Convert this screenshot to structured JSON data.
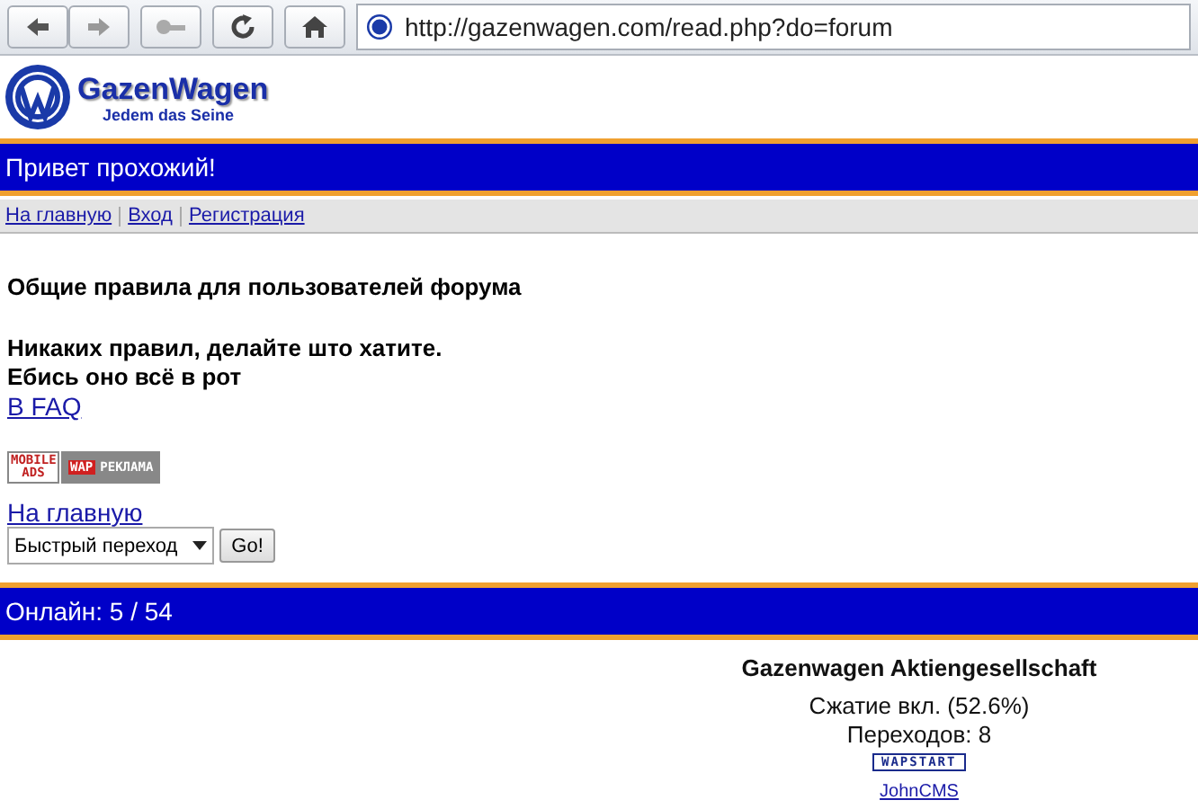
{
  "browser": {
    "url": "http://gazenwagen.com/read.php?do=forum"
  },
  "logo": {
    "name": "GazenWagen",
    "slogan": "Jedem das Seine"
  },
  "greeting": "Привет прохожий!",
  "nav": [
    "На главную",
    "Вход",
    "Регистрация"
  ],
  "content": {
    "title": "Общие правила для пользователей форума",
    "lines": [
      "Никаких правил, делайте што хатите.",
      "Ебись оно всё в рот"
    ],
    "link": "В FAQ"
  },
  "ad_banners": [
    {
      "top": "MOBILE",
      "bottom": "ADS"
    },
    {
      "left": "WAP",
      "right": "РЕКЛАМА"
    }
  ],
  "home_link": "На главную",
  "quick_jump": {
    "value": "Быстрый переход",
    "button": "Go!"
  },
  "online": "Онлайн: 5 / 54",
  "footer": {
    "company": "Gazenwagen Aktiengesellschaft",
    "compression": "Сжатие вкл. (52.6%)",
    "visits": "Переходов: 8",
    "counter": "WAPSTART",
    "engine_link": "JohnCMS"
  }
}
